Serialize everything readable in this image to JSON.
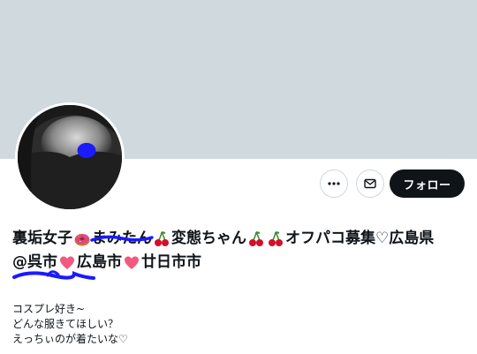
{
  "banner": {
    "color": "#cfd9de"
  },
  "actions": {
    "more_icon": "more-horizontal-icon",
    "mail_icon": "envelope-icon",
    "follow_label": "フォロー"
  },
  "profile": {
    "name_part1": "裏垢女子",
    "name_redacted": "まみたん",
    "name_part2": "変態ちゃん",
    "name_part3": "オフパコ募集♡広島県",
    "name_line2_a": "@呉市",
    "name_line2_b": "広島市",
    "name_line2_c": "廿日市市",
    "emoji": {
      "donut": "donut-emoji",
      "cherry": "cherry-emoji",
      "heart": "heart-emoji"
    }
  },
  "bio": {
    "line1": "コスプレ好き~",
    "line2": "どんな服きてほしい？",
    "line3": "えっちぃのが着たいな♡"
  },
  "colors": {
    "follow_bg": "#0f1419",
    "redaction": "#1a1aff"
  }
}
